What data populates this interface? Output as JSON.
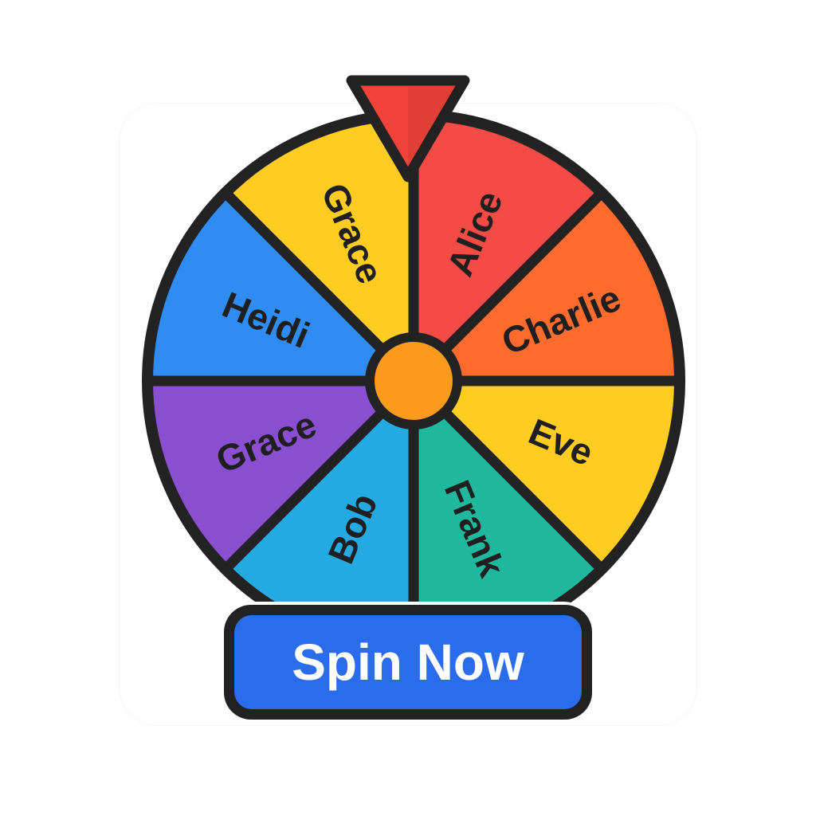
{
  "wheel": {
    "segments": [
      {
        "label": "Alice",
        "color": "#f44b45"
      },
      {
        "label": "Charlie",
        "color": "#ff6b2d"
      },
      {
        "label": "Eve",
        "color": "#ffcc22"
      },
      {
        "label": "Frank",
        "color": "#1fb89c"
      },
      {
        "label": "Bob",
        "color": "#24a9e1"
      },
      {
        "label": "Grace",
        "color": "#8a4fd0"
      },
      {
        "label": "Heidi",
        "color": "#2f8cf2"
      },
      {
        "label": "Grace",
        "color": "#ffcc22"
      }
    ],
    "hub_color": "#fb9a1c",
    "outline_color": "#222222",
    "pointer_color": "#f0433a"
  },
  "spin_button": {
    "label": "Spin Now",
    "color": "#2a6cec"
  }
}
